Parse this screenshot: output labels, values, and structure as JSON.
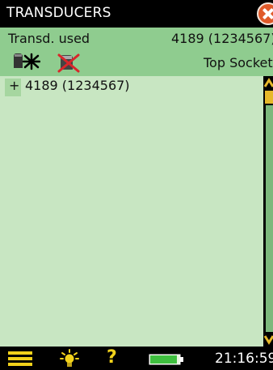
{
  "window": {
    "title": "TRANSDUCERS",
    "close_icon": "close-icon"
  },
  "header": {
    "transducer_used_label": "Transd. used",
    "transducer_used_value": "4189 (1234567)",
    "icons": [
      "microphone-icon",
      "disabled-microphone-icon"
    ],
    "socket": "Top Socket"
  },
  "list": {
    "items": [
      {
        "expander": "+",
        "label": "4189 (1234567)"
      }
    ]
  },
  "statusbar": {
    "icons": [
      "menu-icon",
      "backlight-icon",
      "help-icon",
      "battery-icon"
    ],
    "help_glyph": "?",
    "time": "21:16:59"
  },
  "colors": {
    "header_bg": "#8fcc8f",
    "list_bg": "#c8e6c2",
    "accent_yellow": "#f2d21b",
    "close_red": "#e05a2a"
  }
}
